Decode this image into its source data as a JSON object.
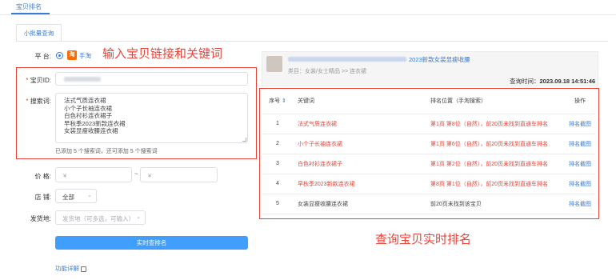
{
  "top_tab": "宝贝排名",
  "sub_tab": "小批量查询",
  "annotations": {
    "input_hint": "输入宝贝链接和关键词",
    "result_hint": "查询宝贝实时排名"
  },
  "form": {
    "platform_label": "平  台:",
    "platform_value": "手淘",
    "item_id_label": "宝贝ID:",
    "keywords_label": "搜索词:",
    "keywords": [
      "法式气质连衣裙",
      "小个子长袖连衣裙",
      "白色衬衫连衣裙子",
      "早秋季2023新款连衣裙",
      "女装显瘦收腰连衣裙"
    ],
    "keywords_hint": "已添加 5 个搜索词，还可添加 5 个搜索词",
    "price_label": "价  格:",
    "price_min_placeholder": "¥",
    "price_sep": "~",
    "price_max_placeholder": "¥",
    "store_label": "店  铺:",
    "store_value": "全部",
    "ship_label": "发货地:",
    "ship_placeholder": "发货地（可多选，可输入）",
    "submit_label": "实时查排名",
    "help_link": "功能详解"
  },
  "product": {
    "title_suffix": "2023新款女装显瘦收腰",
    "category": "类目：女装/女士精品 >> 连衣裙",
    "query_time_label": "查询时间：",
    "query_time": "2023.09.18 14:51:46"
  },
  "table": {
    "headers": {
      "index": "序号",
      "keyword": "关键词",
      "rank": "排名位置（手淘搜索）",
      "op": "操作"
    },
    "rows": [
      {
        "index": "1",
        "keyword": "法式气质连衣裙",
        "rank": "第1页 第8位（自然），前20页未找到直通车排名",
        "op": "排名截图",
        "highlight": true
      },
      {
        "index": "2",
        "keyword": "小个子长袖连衣裙",
        "rank": "第1页 第6位（自然），前20页未找到直通车排名",
        "op": "排名截图",
        "highlight": true
      },
      {
        "index": "3",
        "keyword": "白色衬衫连衣裙子",
        "rank": "第1页 第2位（自然），前20页未找到直通车排名",
        "op": "排名截图",
        "highlight": true
      },
      {
        "index": "4",
        "keyword": "早秋季2023新款连衣裙",
        "rank": "第8页 第1位（自然），前20页未找到直通车排名",
        "op": "排名截图",
        "highlight": true
      },
      {
        "index": "5",
        "keyword": "女装显瘦收腰连衣裙",
        "rank": "前20页未找到该宝贝",
        "op": "排名截图",
        "highlight": false
      }
    ]
  },
  "colors": {
    "accent": "#409eff",
    "annotation": "#e8443a",
    "highlight_text": "#e8443a",
    "brand_icon": "#ff6a00"
  },
  "icons": {
    "taobao": "taobao-icon",
    "sort": "sort-icon",
    "help": "help-doc-icon",
    "select_arrow": "chevron-down-icon"
  }
}
